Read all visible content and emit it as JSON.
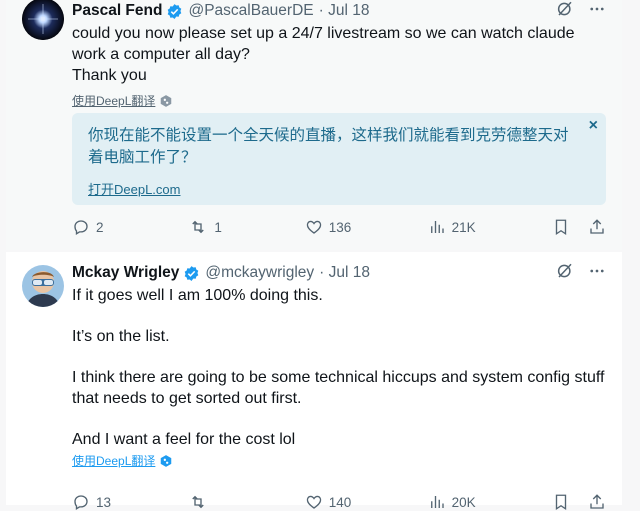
{
  "tweets": [
    {
      "author": "Pascal Fend",
      "handle": "@PascalBauerDE",
      "date": "· Jul 18",
      "lines": [
        "could you now please set up a 24/7 livestream so we can watch claude work a computer all day?",
        "Thank you"
      ],
      "deepl_label": "使用DeepL翻译",
      "translation": "你现在能不能设置一个全天候的直播，这样我们就能看到克劳德整天对着电脑工作了？",
      "translation_link": "打开DeepL.com",
      "translation_close": "×",
      "replies": "2",
      "reposts": "1",
      "likes": "136",
      "views": "21K"
    },
    {
      "author": "Mckay Wrigley",
      "handle": "@mckaywrigley",
      "date": "· Jul 18",
      "lines": [
        "If it goes well I am 100% doing this.",
        "It’s on the list.",
        "I think there are going to be some technical hiccups and system config stuff that needs to get sorted out first.",
        "And I want a feel for the cost lol"
      ],
      "deepl_label": "使用DeepL翻译",
      "replies": "13",
      "reposts": "",
      "likes": "140",
      "views": "20K"
    }
  ],
  "colors": {
    "accent": "#1d9bf0",
    "muted": "#536471",
    "translation_bg": "#e1eff4"
  }
}
